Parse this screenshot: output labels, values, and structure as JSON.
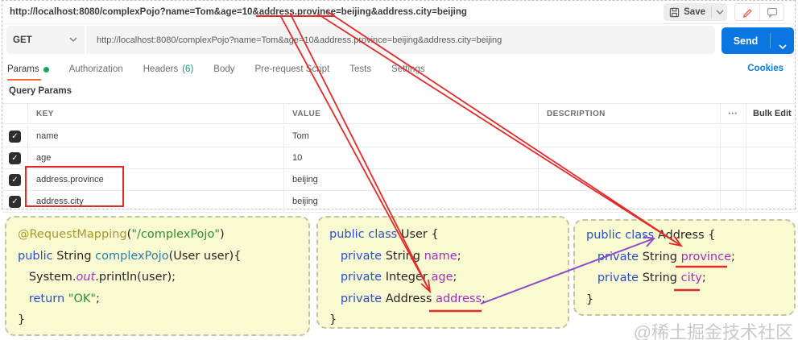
{
  "colors": {
    "anno_red": "#e12b2b",
    "anno_purple": "#8a4dc8",
    "send_blue": "#0b76e1",
    "link_blue": "#097bed",
    "tab_orange": "#ff6c37",
    "dot_green": "#18a558",
    "count_green": "#0f9d6e",
    "panel_bg": "#fafad2",
    "plain": "#262626",
    "kw": "#2950c8",
    "ann": "#a89b2a",
    "str": "#2f8f2f",
    "method": "#2b7fa8",
    "field": "#a030b8"
  },
  "icons": {
    "check": "✓",
    "more": "•••"
  },
  "topbar": {
    "url": "http://localhost:8080/complexPojo?name=Tom&age=10&address.province=beijing&address.city=beijing",
    "save_label": "Save"
  },
  "request": {
    "method": "GET",
    "url": "http://localhost:8080/complexPojo?name=Tom&age=10&address.province=beijing&address.city=beijing",
    "send_label": "Send"
  },
  "tabs": [
    {
      "label": "Params",
      "active": true
    },
    {
      "label": "Authorization"
    },
    {
      "label": "Headers",
      "count": "(6)"
    },
    {
      "label": "Body"
    },
    {
      "label": "Pre-request Script"
    },
    {
      "label": "Tests"
    },
    {
      "label": "Settings"
    }
  ],
  "cookies_link": "Cookies",
  "query_params": {
    "title": "Query Params",
    "columns": [
      "KEY",
      "VALUE",
      "DESCRIPTION"
    ],
    "bulk_edit_label": "Bulk Edit",
    "rows": [
      {
        "key": "name",
        "value": "Tom",
        "checked": true
      },
      {
        "key": "age",
        "value": "10",
        "checked": true
      },
      {
        "key": "address.province",
        "value": "beijing",
        "checked": true
      },
      {
        "key": "address.city",
        "value": "beijing",
        "checked": true
      }
    ]
  },
  "code_panels": {
    "controller": [
      [
        [
          "@RequestMapping",
          "ann"
        ],
        [
          "(",
          "plain"
        ],
        [
          "\"/complexPojo\"",
          "str"
        ],
        [
          ")",
          "plain"
        ]
      ],
      [
        [
          "public ",
          "kw"
        ],
        [
          "String ",
          "plain"
        ],
        [
          "complexPojo",
          "method"
        ],
        [
          "(User user){",
          "plain"
        ]
      ],
      [
        [
          "   System.",
          "plain"
        ],
        [
          "out",
          "field-i"
        ],
        [
          ".println(user);",
          "plain"
        ]
      ],
      [
        [
          "   return ",
          "kw"
        ],
        [
          "\"OK\"",
          "str"
        ],
        [
          ";",
          "plain"
        ]
      ],
      [
        [
          "}",
          "plain"
        ]
      ]
    ],
    "user": [
      [
        [
          "public class ",
          "kw"
        ],
        [
          "User {",
          "plain"
        ]
      ],
      [
        [
          "   private ",
          "kw"
        ],
        [
          "String ",
          "plain"
        ],
        [
          "name",
          "field"
        ],
        [
          ";",
          "plain"
        ]
      ],
      [
        [
          "   private ",
          "kw"
        ],
        [
          "Integer ",
          "plain"
        ],
        [
          "age",
          "field"
        ],
        [
          ";",
          "plain"
        ]
      ],
      [
        [
          "   private ",
          "kw"
        ],
        [
          "Address ",
          "plain"
        ],
        [
          "address",
          "field"
        ],
        [
          ";",
          "plain"
        ]
      ],
      [
        [
          "}",
          "plain"
        ]
      ]
    ],
    "address": [
      [
        [
          "public class ",
          "kw"
        ],
        [
          "Address {",
          "plain"
        ]
      ],
      [
        [
          "   private ",
          "kw"
        ],
        [
          "String ",
          "plain"
        ],
        [
          "province",
          "field"
        ],
        [
          ";",
          "plain"
        ]
      ],
      [
        [
          "   private ",
          "kw"
        ],
        [
          "String ",
          "plain"
        ],
        [
          "city",
          "field"
        ],
        [
          ";",
          "plain"
        ]
      ],
      [
        [
          "}",
          "plain"
        ]
      ]
    ]
  },
  "watermark": "@稀土掘金技术社区"
}
